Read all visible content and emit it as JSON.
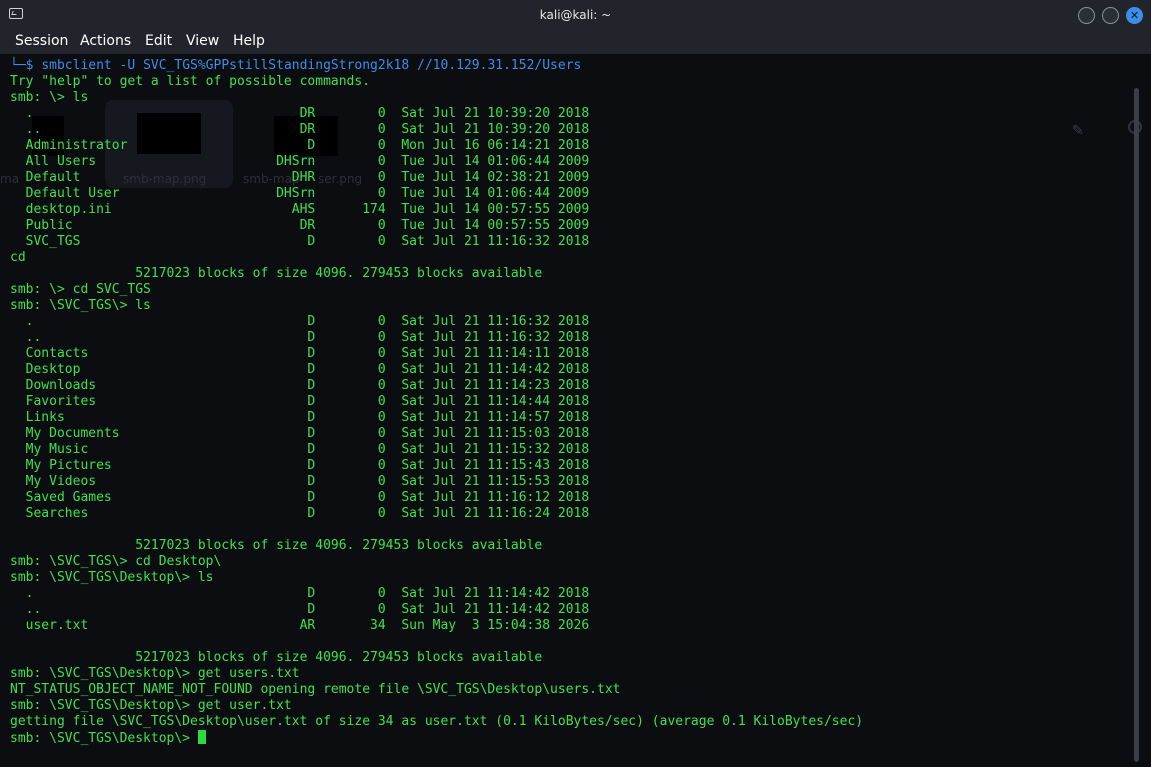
{
  "window": {
    "title": "kali@kali: ~",
    "close_glyph": "✕"
  },
  "menu": {
    "items": [
      "Session",
      "Actions",
      "Edit",
      "View",
      "Help"
    ]
  },
  "background_ghost": {
    "labels": [
      "smb-map.png",
      "smb-map",
      "ser.png",
      "ma"
    ]
  },
  "terminal": {
    "prompt_branch": "└─",
    "prompt_symbol": "$",
    "first_command_name": "smbclient",
    "first_command_args": " -U SVC_TGS%GPPstillStandingStrong2k18 //10.129.31.152/Users",
    "lines": [
      "Try \"help\" to get a list of possible commands.",
      "smb: \\> ls",
      "  .                                  DR        0  Sat Jul 21 10:39:20 2018",
      "  ..                                 DR        0  Sat Jul 21 10:39:20 2018",
      "  Administrator                       D        0  Mon Jul 16 06:14:21 2018",
      "  All Users                       DHSrn        0  Tue Jul 14 01:06:44 2009",
      "  Default                           DHR        0  Tue Jul 14 02:38:21 2009",
      "  Default User                    DHSrn        0  Tue Jul 14 01:06:44 2009",
      "  desktop.ini                       AHS      174  Tue Jul 14 00:57:55 2009",
      "  Public                             DR        0  Tue Jul 14 00:57:55 2009",
      "  SVC_TGS                             D        0  Sat Jul 21 11:16:32 2018",
      "cd",
      "                5217023 blocks of size 4096. 279453 blocks available",
      "smb: \\> cd SVC_TGS",
      "smb: \\SVC_TGS\\> ls",
      "  .                                   D        0  Sat Jul 21 11:16:32 2018",
      "  ..                                  D        0  Sat Jul 21 11:16:32 2018",
      "  Contacts                            D        0  Sat Jul 21 11:14:11 2018",
      "  Desktop                             D        0  Sat Jul 21 11:14:42 2018",
      "  Downloads                           D        0  Sat Jul 21 11:14:23 2018",
      "  Favorites                           D        0  Sat Jul 21 11:14:44 2018",
      "  Links                               D        0  Sat Jul 21 11:14:57 2018",
      "  My Documents                        D        0  Sat Jul 21 11:15:03 2018",
      "  My Music                            D        0  Sat Jul 21 11:15:32 2018",
      "  My Pictures                         D        0  Sat Jul 21 11:15:43 2018",
      "  My Videos                           D        0  Sat Jul 21 11:15:53 2018",
      "  Saved Games                         D        0  Sat Jul 21 11:16:12 2018",
      "  Searches                            D        0  Sat Jul 21 11:16:24 2018",
      "",
      "                5217023 blocks of size 4096. 279453 blocks available",
      "smb: \\SVC_TGS\\> cd Desktop\\",
      "smb: \\SVC_TGS\\Desktop\\> ls",
      "  .                                   D        0  Sat Jul 21 11:14:42 2018",
      "  ..                                  D        0  Sat Jul 21 11:14:42 2018",
      "  user.txt                           AR       34  Sun May  3 15:04:38 2026",
      "",
      "                5217023 blocks of size 4096. 279453 blocks available",
      "smb: \\SVC_TGS\\Desktop\\> get users.txt",
      "NT_STATUS_OBJECT_NAME_NOT_FOUND opening remote file \\SVC_TGS\\Desktop\\users.txt",
      "smb: \\SVC_TGS\\Desktop\\> get user.txt",
      "getting file \\SVC_TGS\\Desktop\\user.txt of size 34 as user.txt (0.1 KiloBytes/sec) (average 0.1 KiloBytes/sec)"
    ],
    "final_prompt": "smb: \\SVC_TGS\\Desktop\\> "
  }
}
